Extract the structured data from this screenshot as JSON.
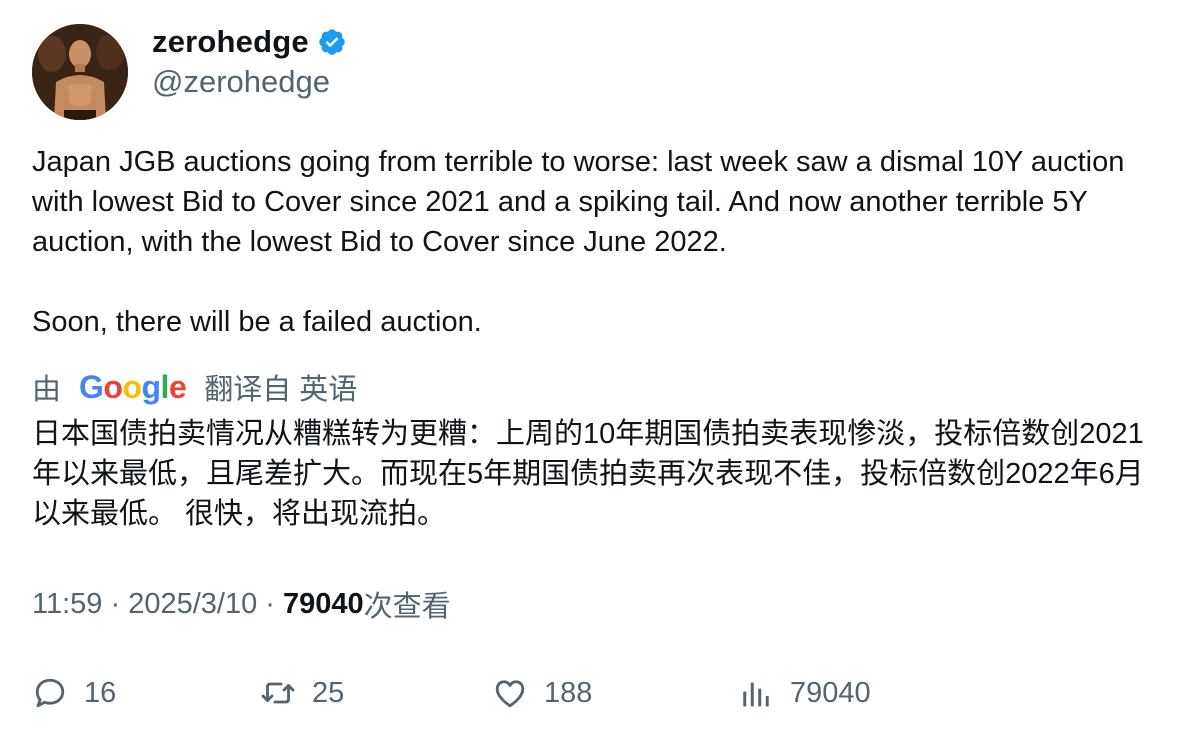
{
  "user": {
    "display_name": "zerohedge",
    "handle": "@zerohedge",
    "verified_icon": "verified-badge-icon",
    "accent_color": "#1d9bf0"
  },
  "tweet": {
    "line1": "Japan JGB auctions going from terrible to worse: last week saw a dismal 10Y auction with lowest Bid to Cover since 2021 and a spiking tail. And now another terrible 5Y auction, with the lowest Bid to Cover since June 2022.",
    "line2": "Soon, there will be a failed auction."
  },
  "translation": {
    "prefix": "由",
    "provider_logo": {
      "G": "G",
      "o1": "o",
      "o2": "o",
      "g": "g",
      "l": "l",
      "e": "e"
    },
    "suffix": "翻译自 英语",
    "text": "日本国债拍卖情况从糟糕转为更糟：上周的10年期国债拍卖表现惨淡，投标倍数创2021年以来最低，且尾差扩大。而现在5年期国债拍卖再次表现不佳，投标倍数创2022年6月以来最低。 很快，将出现流拍。"
  },
  "meta": {
    "time": "11:59",
    "sep1": " · ",
    "date": "2025/3/10",
    "sep2": " · ",
    "views_count": "79040",
    "views_label": "次查看"
  },
  "actions": {
    "reply": {
      "icon": "reply-icon",
      "count": "16"
    },
    "retweet": {
      "icon": "retweet-icon",
      "count": "25"
    },
    "like": {
      "icon": "heart-icon",
      "count": "188"
    },
    "views": {
      "icon": "analytics-icon",
      "count": "79040"
    }
  }
}
